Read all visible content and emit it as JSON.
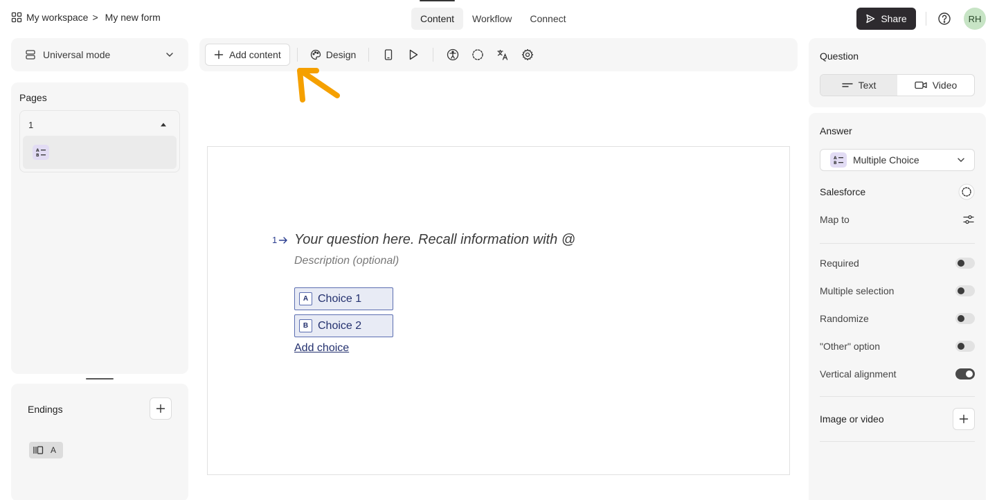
{
  "breadcrumb": {
    "workspace": "My workspace",
    "separator": ">",
    "form": "My new form"
  },
  "tabs": [
    {
      "label": "Content",
      "active": true
    },
    {
      "label": "Workflow",
      "active": false
    },
    {
      "label": "Connect",
      "active": false
    }
  ],
  "header": {
    "share_label": "Share",
    "avatar_initials": "RH"
  },
  "mode": {
    "label": "Universal mode"
  },
  "pages": {
    "title": "Pages",
    "group_label": "1"
  },
  "endings": {
    "title": "Endings",
    "chip_letter": "A"
  },
  "toolbar": {
    "add_content_label": "Add content",
    "design_label": "Design"
  },
  "question": {
    "number": "1",
    "text": "Your question here. Recall information with @",
    "description": "Description (optional)",
    "choices": [
      {
        "key": "A",
        "label": "Choice 1"
      },
      {
        "key": "B",
        "label": "Choice 2"
      }
    ],
    "add_choice_label": "Add choice"
  },
  "right_panel": {
    "question_title": "Question",
    "segments": [
      {
        "label": "Text",
        "active": true
      },
      {
        "label": "Video",
        "active": false
      }
    ],
    "answer_title": "Answer",
    "answer_type": "Multiple Choice",
    "salesforce_label": "Salesforce",
    "map_to_label": "Map to",
    "toggles": [
      {
        "label": "Required",
        "on": false
      },
      {
        "label": "Multiple selection",
        "on": false
      },
      {
        "label": "Randomize",
        "on": false
      },
      {
        "label": "\"Other\" option",
        "on": false
      },
      {
        "label": "Vertical alignment",
        "on": true
      }
    ],
    "image_video_label": "Image or video"
  },
  "colors": {
    "accent_arrow": "#f5a000",
    "choice_text": "#23306e",
    "share_bg": "#2d2a2e",
    "avatar_bg": "#c7e4c5"
  }
}
